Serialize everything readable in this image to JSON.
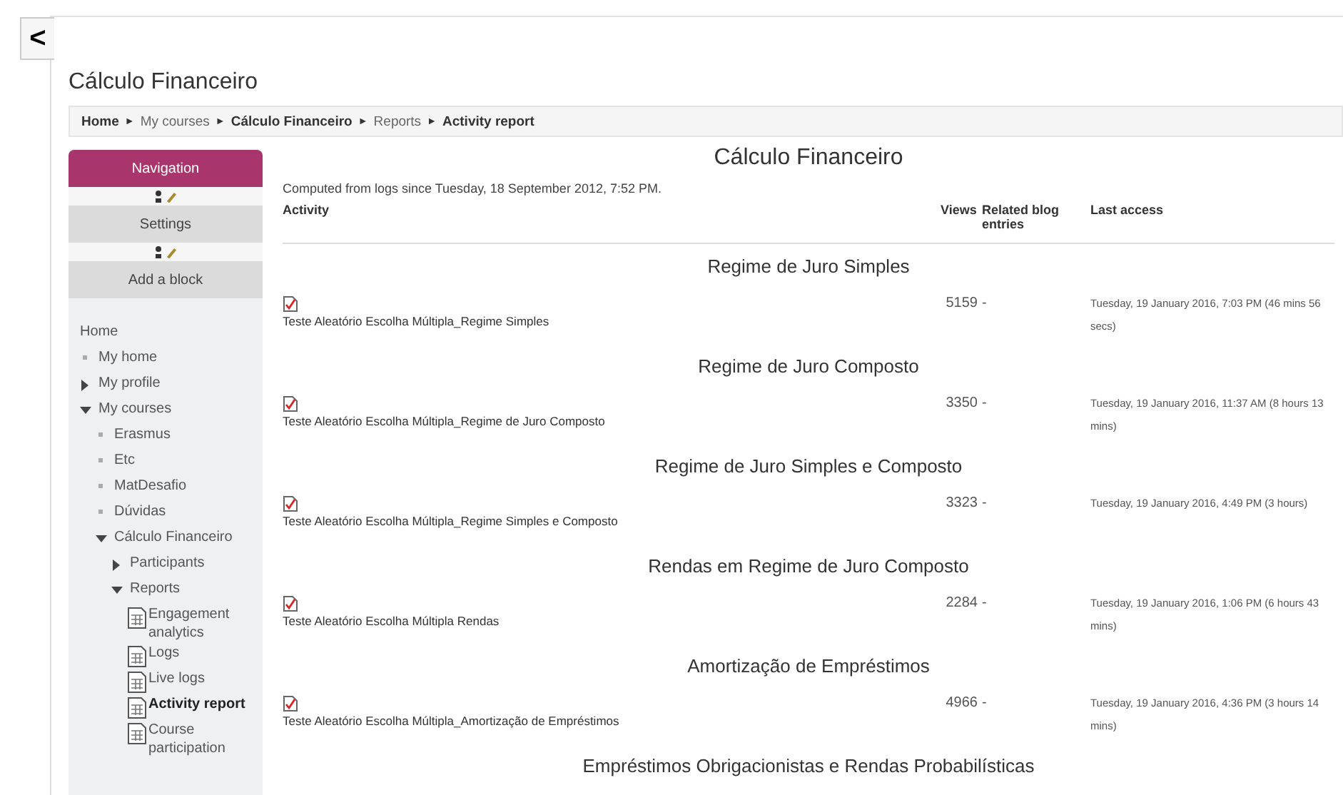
{
  "back_button": {
    "label": "<"
  },
  "page_title": "Cálculo Financeiro",
  "breadcrumb": [
    {
      "label": "Home",
      "bold": true
    },
    {
      "label": "My courses",
      "bold": false
    },
    {
      "label": "Cálculo Financeiro",
      "bold": true
    },
    {
      "label": "Reports",
      "bold": false
    },
    {
      "label": "Activity report",
      "bold": true
    }
  ],
  "breadcrumb_separator": "►",
  "blocks": [
    {
      "title": "Navigation",
      "selected": true
    },
    {
      "title": "Settings",
      "selected": false
    }
  ],
  "add_block": "Add a block",
  "nav_tree": {
    "label": "Home",
    "children": [
      {
        "label": "My home",
        "kind": "leaf"
      },
      {
        "label": "My profile",
        "kind": "branch",
        "expanded": false
      },
      {
        "label": "My courses",
        "kind": "branch",
        "expanded": true,
        "children": [
          {
            "label": "Erasmus",
            "kind": "leaf"
          },
          {
            "label": "Etc",
            "kind": "leaf"
          },
          {
            "label": "MatDesafio",
            "kind": "leaf"
          },
          {
            "label": "Dúvidas",
            "kind": "leaf"
          },
          {
            "label": "Cálculo Financeiro",
            "kind": "branch",
            "expanded": true,
            "children": [
              {
                "label": "Participants",
                "kind": "branch",
                "expanded": false
              },
              {
                "label": "Reports",
                "kind": "branch",
                "expanded": true,
                "children": [
                  {
                    "label": "Engagement analytics",
                    "kind": "report",
                    "selected": false
                  },
                  {
                    "label": "Logs",
                    "kind": "report",
                    "selected": false
                  },
                  {
                    "label": "Live logs",
                    "kind": "report",
                    "selected": false
                  },
                  {
                    "label": "Activity report",
                    "kind": "report",
                    "selected": true
                  },
                  {
                    "label": "Course participation",
                    "kind": "report",
                    "selected": false
                  }
                ]
              }
            ]
          }
        ]
      }
    ]
  },
  "report": {
    "title": "Cálculo Financeiro",
    "note": "Computed from logs since Tuesday, 18 September 2012, 7:52 PM.",
    "columns": [
      "Activity",
      "Views",
      "Related blog entries",
      "Last access"
    ],
    "sections": [
      {
        "heading": "Regime de Juro Simples",
        "rows": [
          {
            "activity": "Teste Aleatório Escolha Múltipla_Regime Simples",
            "views": "5159",
            "blog": "-",
            "last_access": "Tuesday, 19 January 2016, 7:03 PM (46 mins 56 secs)"
          }
        ]
      },
      {
        "heading": "Regime de Juro Composto",
        "rows": [
          {
            "activity": "Teste Aleatório Escolha Múltipla_Regime de Juro Composto",
            "views": "3350",
            "blog": "-",
            "last_access": "Tuesday, 19 January 2016, 11:37 AM (8 hours 13 mins)"
          }
        ]
      },
      {
        "heading": "Regime de Juro Simples e Composto",
        "rows": [
          {
            "activity": "Teste Aleatório Escolha Múltipla_Regime Simples e Composto",
            "views": "3323",
            "blog": "-",
            "last_access": "Tuesday, 19 January 2016, 4:49 PM (3 hours)"
          }
        ]
      },
      {
        "heading": "Rendas em Regime de Juro Composto",
        "rows": [
          {
            "activity": "Teste Aleatório Escolha Múltipla Rendas",
            "views": "2284",
            "blog": "-",
            "last_access": "Tuesday, 19 January 2016, 1:06 PM (6 hours 43 mins)"
          }
        ]
      },
      {
        "heading": "Amortização de Empréstimos",
        "rows": [
          {
            "activity": "Teste Aleatório Escolha Múltipla_Amortização de Empréstimos",
            "views": "4966",
            "blog": "-",
            "last_access": "Tuesday, 19 January 2016, 4:36 PM (3 hours 14 mins)"
          }
        ]
      },
      {
        "heading": "Empréstimos Obrigacionistas e Rendas Probabilísticas"
      }
    ]
  }
}
